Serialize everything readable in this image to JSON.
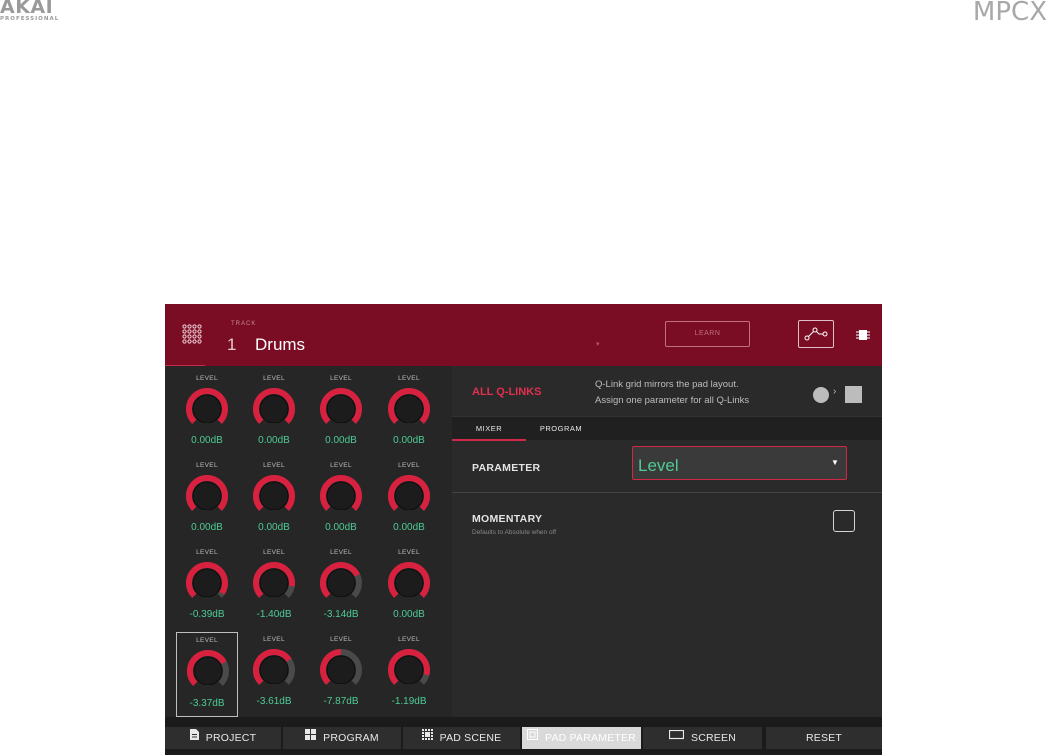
{
  "brand": {
    "left_logo": "AKAI",
    "left_sub": "PROFESSIONAL",
    "right_logo": "MPCX"
  },
  "header": {
    "track_label": "TRACK",
    "track_number": "1",
    "track_name": "Drums",
    "learn_label": "LEARN",
    "icons": [
      "pad-grid-icon",
      "curve-icon",
      "chip-icon"
    ]
  },
  "knobs": [
    {
      "label": "LEVEL",
      "value": "0.00dB",
      "level": 1.0
    },
    {
      "label": "LEVEL",
      "value": "0.00dB",
      "level": 1.0
    },
    {
      "label": "LEVEL",
      "value": "0.00dB",
      "level": 1.0
    },
    {
      "label": "LEVEL",
      "value": "0.00dB",
      "level": 1.0
    },
    {
      "label": "LEVEL",
      "value": "0.00dB",
      "level": 1.0
    },
    {
      "label": "LEVEL",
      "value": "0.00dB",
      "level": 1.0
    },
    {
      "label": "LEVEL",
      "value": "0.00dB",
      "level": 1.0
    },
    {
      "label": "LEVEL",
      "value": "0.00dB",
      "level": 1.0
    },
    {
      "label": "LEVEL",
      "value": "-0.39dB",
      "level": 0.96
    },
    {
      "label": "LEVEL",
      "value": "-1.40dB",
      "level": 0.87
    },
    {
      "label": "LEVEL",
      "value": "-3.14dB",
      "level": 0.74
    },
    {
      "label": "LEVEL",
      "value": "0.00dB",
      "level": 1.0
    },
    {
      "label": "LEVEL",
      "value": "-3.37dB",
      "level": 0.73,
      "selected": true
    },
    {
      "label": "LEVEL",
      "value": "-3.61dB",
      "level": 0.71
    },
    {
      "label": "LEVEL",
      "value": "-7.87dB",
      "level": 0.5
    },
    {
      "label": "LEVEL",
      "value": "-1.19dB",
      "level": 0.89
    }
  ],
  "qlinks": {
    "title": "ALL Q-LINKS",
    "desc_line1": "Q-Link grid mirrors the pad layout.",
    "desc_line2": "Assign one parameter for all Q-Links",
    "tabs": [
      {
        "label": "MIXER",
        "active": true
      },
      {
        "label": "PROGRAM",
        "active": false
      }
    ],
    "parameter_label": "PARAMETER",
    "parameter_value": "Level",
    "momentary_label": "MOMENTARY",
    "momentary_sub": "Defaults to Absolute when off",
    "momentary_checked": false
  },
  "footer": {
    "buttons": [
      {
        "label": "PROJECT",
        "icon": "file-icon",
        "active": false
      },
      {
        "label": "PROGRAM",
        "icon": "grid4-icon",
        "active": false
      },
      {
        "label": "PAD SCENE",
        "icon": "pad-scene-icon",
        "active": false
      },
      {
        "label": "PAD PARAMETER",
        "icon": "pad-param-icon",
        "active": true
      },
      {
        "label": "SCREEN",
        "icon": "monitor-icon",
        "active": false
      },
      {
        "label": "RESET",
        "icon": "",
        "active": false
      }
    ]
  },
  "colors": {
    "header_bg": "#7a0d24",
    "accent_red": "#d02848",
    "value_green": "#4ecb96",
    "panel_dark": "#262626"
  }
}
